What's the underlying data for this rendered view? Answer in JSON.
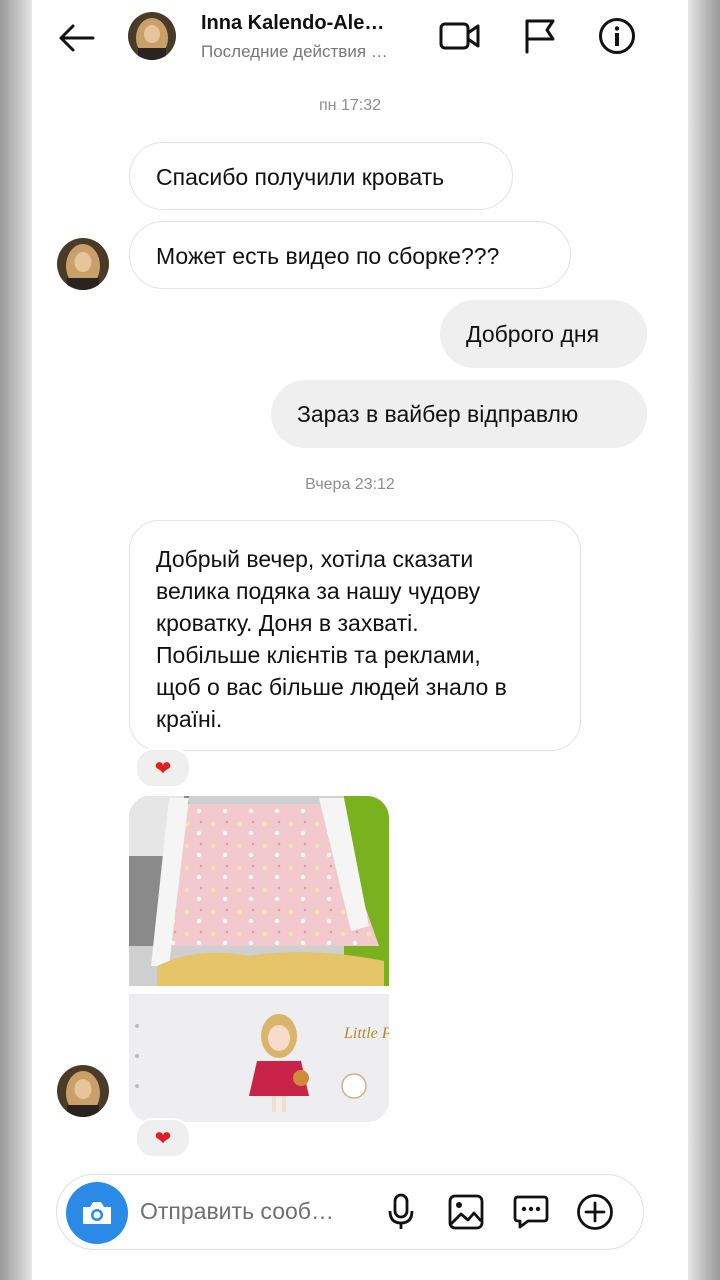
{
  "header": {
    "contact_name": "Inna Kalendo-Ale…",
    "status": "Последние действия …"
  },
  "messages": {
    "sep1": "пн 17:32",
    "m1": "Спасибо получили кровать",
    "m2": "Может есть видео по сборке???",
    "m3": "Доброго дня",
    "m4": "Зараз в вайбер відправлю",
    "sep2": "Вчера 23:12",
    "m5_lines": [
      "Добрый вечер, хотіла сказати",
      "велика подяка за нашу чудову",
      "кроватку. Доня в захваті.",
      "Побільше клієнтів та реклами,",
      "щоб о вас більше людей знало в",
      "країні."
    ],
    "reaction": "❤",
    "photo_text": "Little Princess"
  },
  "composer": {
    "placeholder": "Отправить сооб…"
  },
  "colors": {
    "accent": "#2a8ae6",
    "outgoing_bubble": "#efefef",
    "heart": "#e02020"
  },
  "icons": [
    "back-arrow-icon",
    "video-call-icon",
    "flag-icon",
    "info-icon",
    "camera-icon",
    "microphone-icon",
    "gallery-icon",
    "sticker-icon",
    "plus-icon"
  ]
}
